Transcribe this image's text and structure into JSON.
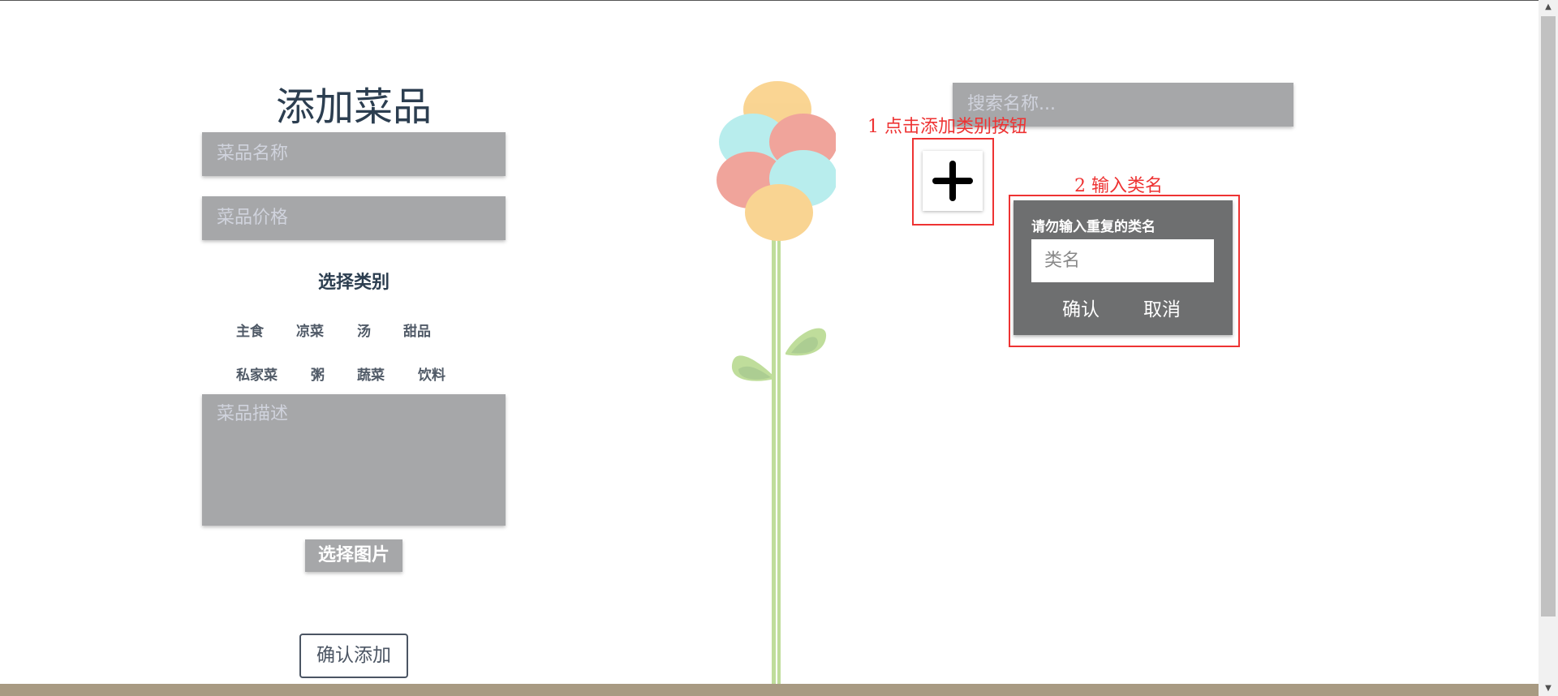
{
  "form": {
    "title": "添加菜品",
    "name_placeholder": "菜品名称",
    "price_placeholder": "菜品价格",
    "category_label": "选择类别",
    "categories": [
      "主食",
      "凉菜",
      "汤",
      "甜品",
      "私家菜",
      "粥",
      "蔬菜",
      "饮料"
    ],
    "description_placeholder": "菜品描述",
    "pick_image_label": "选择图片",
    "confirm_label": "确认添加"
  },
  "search": {
    "placeholder": "搜索名称..."
  },
  "annotations": {
    "step1": "1 点击添加类别按钮",
    "step2": "2 输入类名"
  },
  "dialog": {
    "title": "请勿输入重复的类名",
    "input_placeholder": "类名",
    "confirm_label": "确认",
    "cancel_label": "取消"
  },
  "icons": {
    "add": "plus-icon",
    "scroll_up": "scroll-up-arrow-icon",
    "scroll_down": "scroll-down-arrow-icon"
  },
  "colors": {
    "annotation": "#ee3333",
    "field_bg": "#a6a7a9",
    "dialog_bg": "#6e6f70",
    "footer_bar": "#a89a82"
  }
}
